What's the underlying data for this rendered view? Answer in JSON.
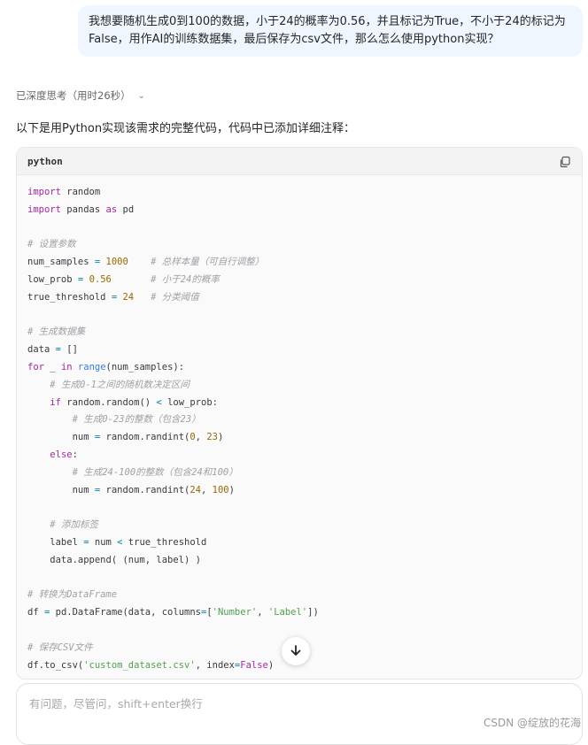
{
  "user_message": "我想要随机生成0到100的数据，小于24的概率为0.56，并且标记为True，不小于24的标记为False，用作AI的训练数据集，最后保存为csv文件，那么怎么使用python实现？",
  "thinking": {
    "label": "已深度思考（用时26秒）"
  },
  "intro": "以下是用Python实现该需求的完整代码，代码中已添加详细注释：",
  "code_block": {
    "language": "python",
    "copy_icon": "copy-icon"
  },
  "code_lines": [
    [
      [
        "kw",
        "import"
      ],
      [
        "t",
        " random"
      ]
    ],
    [
      [
        "kw",
        "import"
      ],
      [
        "t",
        " pandas "
      ],
      [
        "kw",
        "as"
      ],
      [
        "t",
        " pd"
      ]
    ],
    [],
    [
      [
        "cm",
        "# 设置参数"
      ]
    ],
    [
      [
        "t",
        "num_samples "
      ],
      [
        "op",
        "="
      ],
      [
        "t",
        " "
      ],
      [
        "num",
        "1000"
      ],
      [
        "t",
        "    "
      ],
      [
        "cm",
        "# 总样本量（可自行调整）"
      ]
    ],
    [
      [
        "t",
        "low_prob "
      ],
      [
        "op",
        "="
      ],
      [
        "t",
        " "
      ],
      [
        "num",
        "0.56"
      ],
      [
        "t",
        "       "
      ],
      [
        "cm",
        "# 小于24的概率"
      ]
    ],
    [
      [
        "t",
        "true_threshold "
      ],
      [
        "op",
        "="
      ],
      [
        "t",
        " "
      ],
      [
        "num",
        "24"
      ],
      [
        "t",
        "   "
      ],
      [
        "cm",
        "# 分类阈值"
      ]
    ],
    [],
    [
      [
        "cm",
        "# 生成数据集"
      ]
    ],
    [
      [
        "t",
        "data "
      ],
      [
        "op",
        "="
      ],
      [
        "t",
        " []"
      ]
    ],
    [
      [
        "kw",
        "for"
      ],
      [
        "t",
        " _ "
      ],
      [
        "kw",
        "in"
      ],
      [
        "t",
        " "
      ],
      [
        "bi",
        "range"
      ],
      [
        "t",
        "(num_samples):"
      ]
    ],
    [
      [
        "t",
        "    "
      ],
      [
        "cm",
        "# 生成0-1之间的随机数决定区间"
      ]
    ],
    [
      [
        "t",
        "    "
      ],
      [
        "kw",
        "if"
      ],
      [
        "t",
        " random.random() "
      ],
      [
        "op",
        "<"
      ],
      [
        "t",
        " low_prob:"
      ]
    ],
    [
      [
        "t",
        "        "
      ],
      [
        "cm",
        "# 生成0-23的整数（包含23）"
      ]
    ],
    [
      [
        "t",
        "        num "
      ],
      [
        "op",
        "="
      ],
      [
        "t",
        " random.randint("
      ],
      [
        "num",
        "0"
      ],
      [
        "t",
        ", "
      ],
      [
        "num",
        "23"
      ],
      [
        "t",
        ")"
      ]
    ],
    [
      [
        "t",
        "    "
      ],
      [
        "kw",
        "else"
      ],
      [
        "t",
        ":"
      ]
    ],
    [
      [
        "t",
        "        "
      ],
      [
        "cm",
        "# 生成24-100的整数（包含24和100）"
      ]
    ],
    [
      [
        "t",
        "        num "
      ],
      [
        "op",
        "="
      ],
      [
        "t",
        " random.randint("
      ],
      [
        "num",
        "24"
      ],
      [
        "t",
        ", "
      ],
      [
        "num",
        "100"
      ],
      [
        "t",
        ")"
      ]
    ],
    [],
    [
      [
        "t",
        "    "
      ],
      [
        "cm",
        "# 添加标签"
      ]
    ],
    [
      [
        "t",
        "    label "
      ],
      [
        "op",
        "="
      ],
      [
        "t",
        " num "
      ],
      [
        "op",
        "<"
      ],
      [
        "t",
        " true_threshold"
      ]
    ],
    [
      [
        "t",
        "    data.append( (num, label) )"
      ]
    ],
    [],
    [
      [
        "cm",
        "# 转换为DataFrame"
      ]
    ],
    [
      [
        "t",
        "df "
      ],
      [
        "op",
        "="
      ],
      [
        "t",
        " pd.DataFrame(data, columns"
      ],
      [
        "op",
        "="
      ],
      [
        "t",
        "["
      ],
      [
        "str",
        "'Number'"
      ],
      [
        "t",
        ", "
      ],
      [
        "str",
        "'Label'"
      ],
      [
        "t",
        "])"
      ]
    ],
    [],
    [
      [
        "cm",
        "# 保存CSV文件"
      ]
    ],
    [
      [
        "t",
        "df.to_csv("
      ],
      [
        "str",
        "'custom_dataset.csv'"
      ],
      [
        "t",
        ", index"
      ],
      [
        "op",
        "="
      ],
      [
        "kw",
        "False"
      ],
      [
        "t",
        ")"
      ]
    ]
  ],
  "scroll_down_icon": "arrow-down-icon",
  "input": {
    "placeholder": "有问题，尽管问，shift+enter换行",
    "value": ""
  },
  "watermark": "CSDN @绽放的花海"
}
